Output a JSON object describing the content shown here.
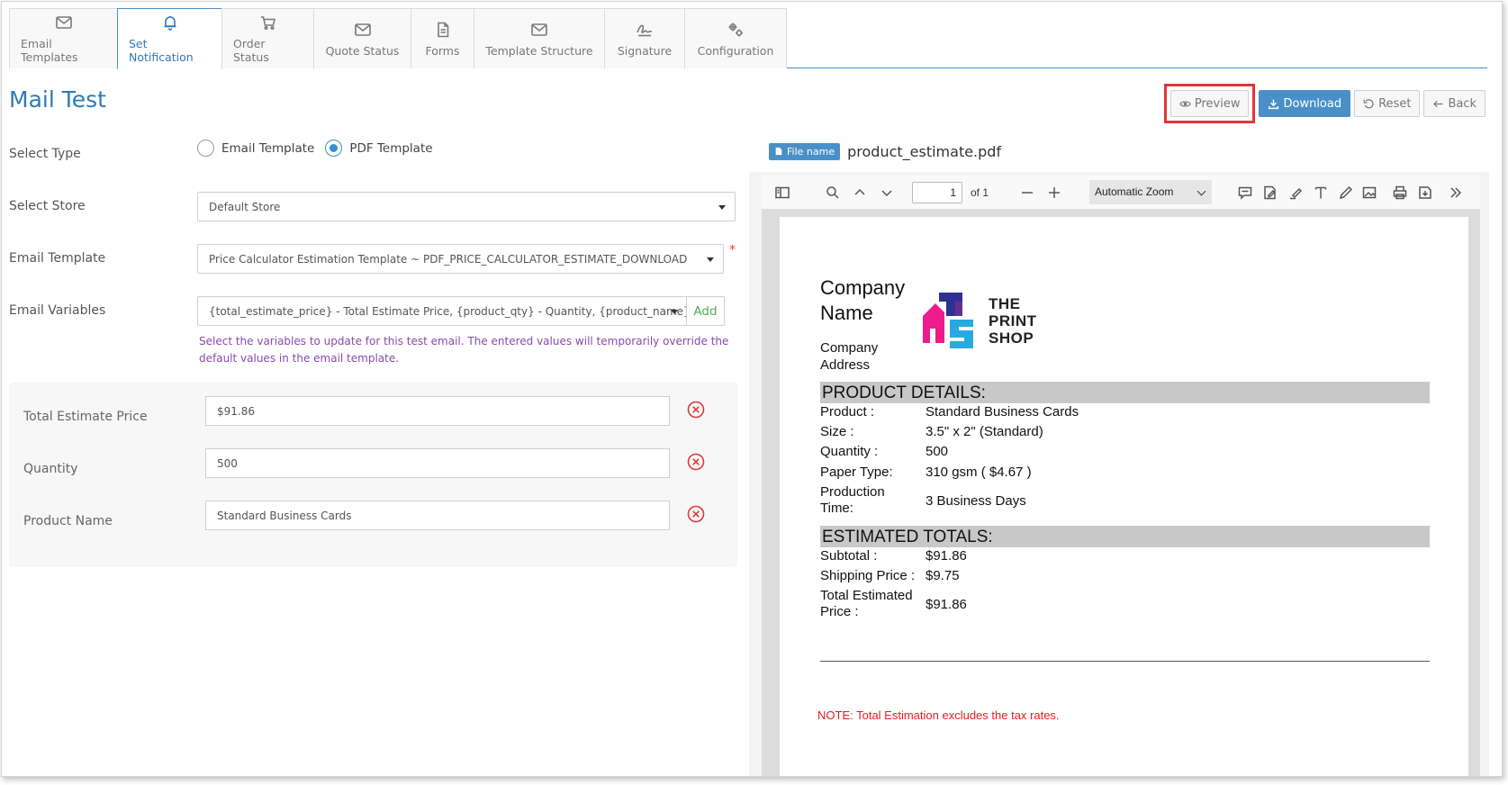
{
  "tabs": [
    {
      "label": "Email Templates",
      "icon": "mail-icon"
    },
    {
      "label": "Set Notification",
      "icon": "bell-icon"
    },
    {
      "label": "Order Status",
      "icon": "cart-icon"
    },
    {
      "label": "Quote Status",
      "icon": "mail-icon"
    },
    {
      "label": "Forms",
      "icon": "document-icon"
    },
    {
      "label": "Template Structure",
      "icon": "mail-icon"
    },
    {
      "label": "Signature",
      "icon": "signature-icon"
    },
    {
      "label": "Configuration",
      "icon": "gears-icon"
    }
  ],
  "page": {
    "title": "Mail Test"
  },
  "actions": {
    "preview": "Preview",
    "download": "Download",
    "reset": "Reset",
    "back": "Back"
  },
  "form": {
    "select_type_label": "Select Type",
    "type_options": [
      "Email Template",
      "PDF Template"
    ],
    "type_selected": "PDF Template",
    "store_label": "Select Store",
    "store_value": "Default Store",
    "template_label": "Email Template",
    "template_value": "Price Calculator Estimation Template ~ PDF_PRICE_CALCULATOR_ESTIMATE_DOWNLOAD",
    "required_mark": "*",
    "variables_label": "Email Variables",
    "variables_value": "{total_estimate_price} - Total Estimate Price, {product_qty} - Quantity, {product_name} - Pro",
    "add_label": "Add",
    "hint": "Select the variables to update for this test email. The entered values will temporarily override the default values in the email template."
  },
  "variables": [
    {
      "label": "Total Estimate Price",
      "value": "$91.86"
    },
    {
      "label": "Quantity",
      "value": "500"
    },
    {
      "label": "Product Name",
      "value": "Standard Business Cards"
    }
  ],
  "viewer": {
    "file_badge": "File name",
    "file_name": "product_estimate.pdf",
    "page_number": "1",
    "page_of": "of 1",
    "zoom": "Automatic Zoom"
  },
  "pdf": {
    "company_name": "Company Name",
    "company_address": "Company Address",
    "logo_lines": [
      "THE",
      "PRINT",
      "SHOP"
    ],
    "product_details_title": "PRODUCT DETAILS:",
    "product_details": [
      {
        "label": "Product :",
        "value": "Standard Business Cards"
      },
      {
        "label": "Size :",
        "value": "3.5\" x 2\" (Standard)"
      },
      {
        "label": "Quantity :",
        "value": "500"
      },
      {
        "label": "Paper Type:",
        "value": "310 gsm ( $4.67 )"
      },
      {
        "label": "Production Time:",
        "value": "3 Business Days"
      }
    ],
    "totals_title": "ESTIMATED TOTALS:",
    "totals": [
      {
        "label": "Subtotal :",
        "value": "$91.86"
      },
      {
        "label": "Shipping Price :",
        "value": "$9.75"
      },
      {
        "label": "Total Estimated Price :",
        "value": "$91.86"
      }
    ],
    "note": "NOTE: Total Estimation excludes the tax rates."
  },
  "colors": {
    "accent": "#2f7ab8",
    "primary_button": "#4a90c8",
    "highlight": "#e0373a",
    "note": "#e01f1f",
    "add": "#4caf50"
  }
}
